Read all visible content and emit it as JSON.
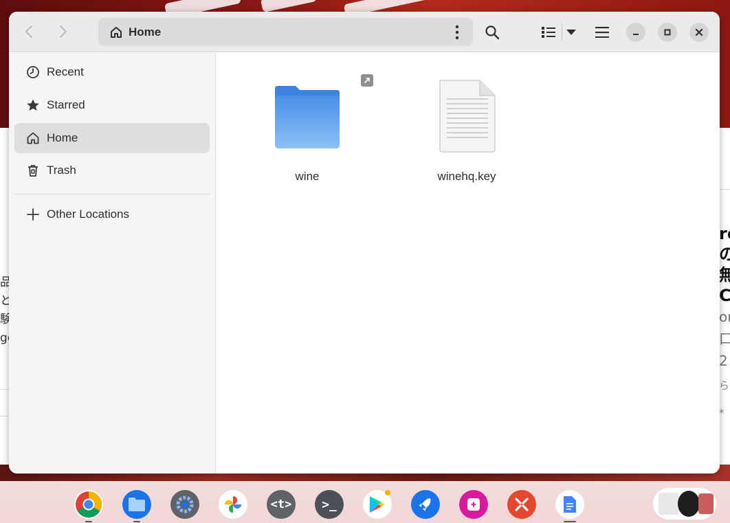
{
  "window": {
    "location": "Home",
    "sidebar": {
      "items": [
        {
          "label": "Recent",
          "icon": "clock-icon"
        },
        {
          "label": "Starred",
          "icon": "star-icon"
        },
        {
          "label": "Home",
          "icon": "home-icon",
          "active": true
        },
        {
          "label": "Trash",
          "icon": "trash-icon"
        }
      ],
      "other_locations": {
        "label": "Other Locations",
        "icon": "plus-icon"
      }
    },
    "files": [
      {
        "name": "wine",
        "type": "folder",
        "symlink": true
      },
      {
        "name": "winehq.key",
        "type": "text-file"
      }
    ],
    "colors": {
      "folder": "#4a8fe6",
      "accent_close": "#2e2e2e",
      "headerbar": "#ebebeb"
    }
  },
  "background": {
    "left_text": [
      "品",
      "と",
      "験",
      "ge"
    ],
    "right_text": [
      "re",
      "の無",
      "C"
    ],
    "right_subtext": [
      "om",
      "口",
      "2"
    ],
    "right_small": [
      "ら*"
    ]
  },
  "shelf": {
    "apps": [
      {
        "name": "chrome",
        "icon": "chrome-icon",
        "running": true
      },
      {
        "name": "files",
        "icon": "files-icon",
        "running": true
      },
      {
        "name": "settings",
        "icon": "settings-icon"
      },
      {
        "name": "photos",
        "icon": "photos-icon"
      },
      {
        "name": "text",
        "icon": "text-app-icon",
        "glyph": "<t>"
      },
      {
        "name": "terminal",
        "icon": "terminal-icon",
        "glyph": ">_"
      },
      {
        "name": "play-store",
        "icon": "play-store-icon"
      },
      {
        "name": "rocket",
        "icon": "rocket-icon"
      },
      {
        "name": "gallery",
        "icon": "gallery-icon"
      },
      {
        "name": "remote-desktop",
        "icon": "remote-desktop-icon"
      },
      {
        "name": "docs",
        "icon": "docs-icon",
        "running": true
      }
    ]
  }
}
